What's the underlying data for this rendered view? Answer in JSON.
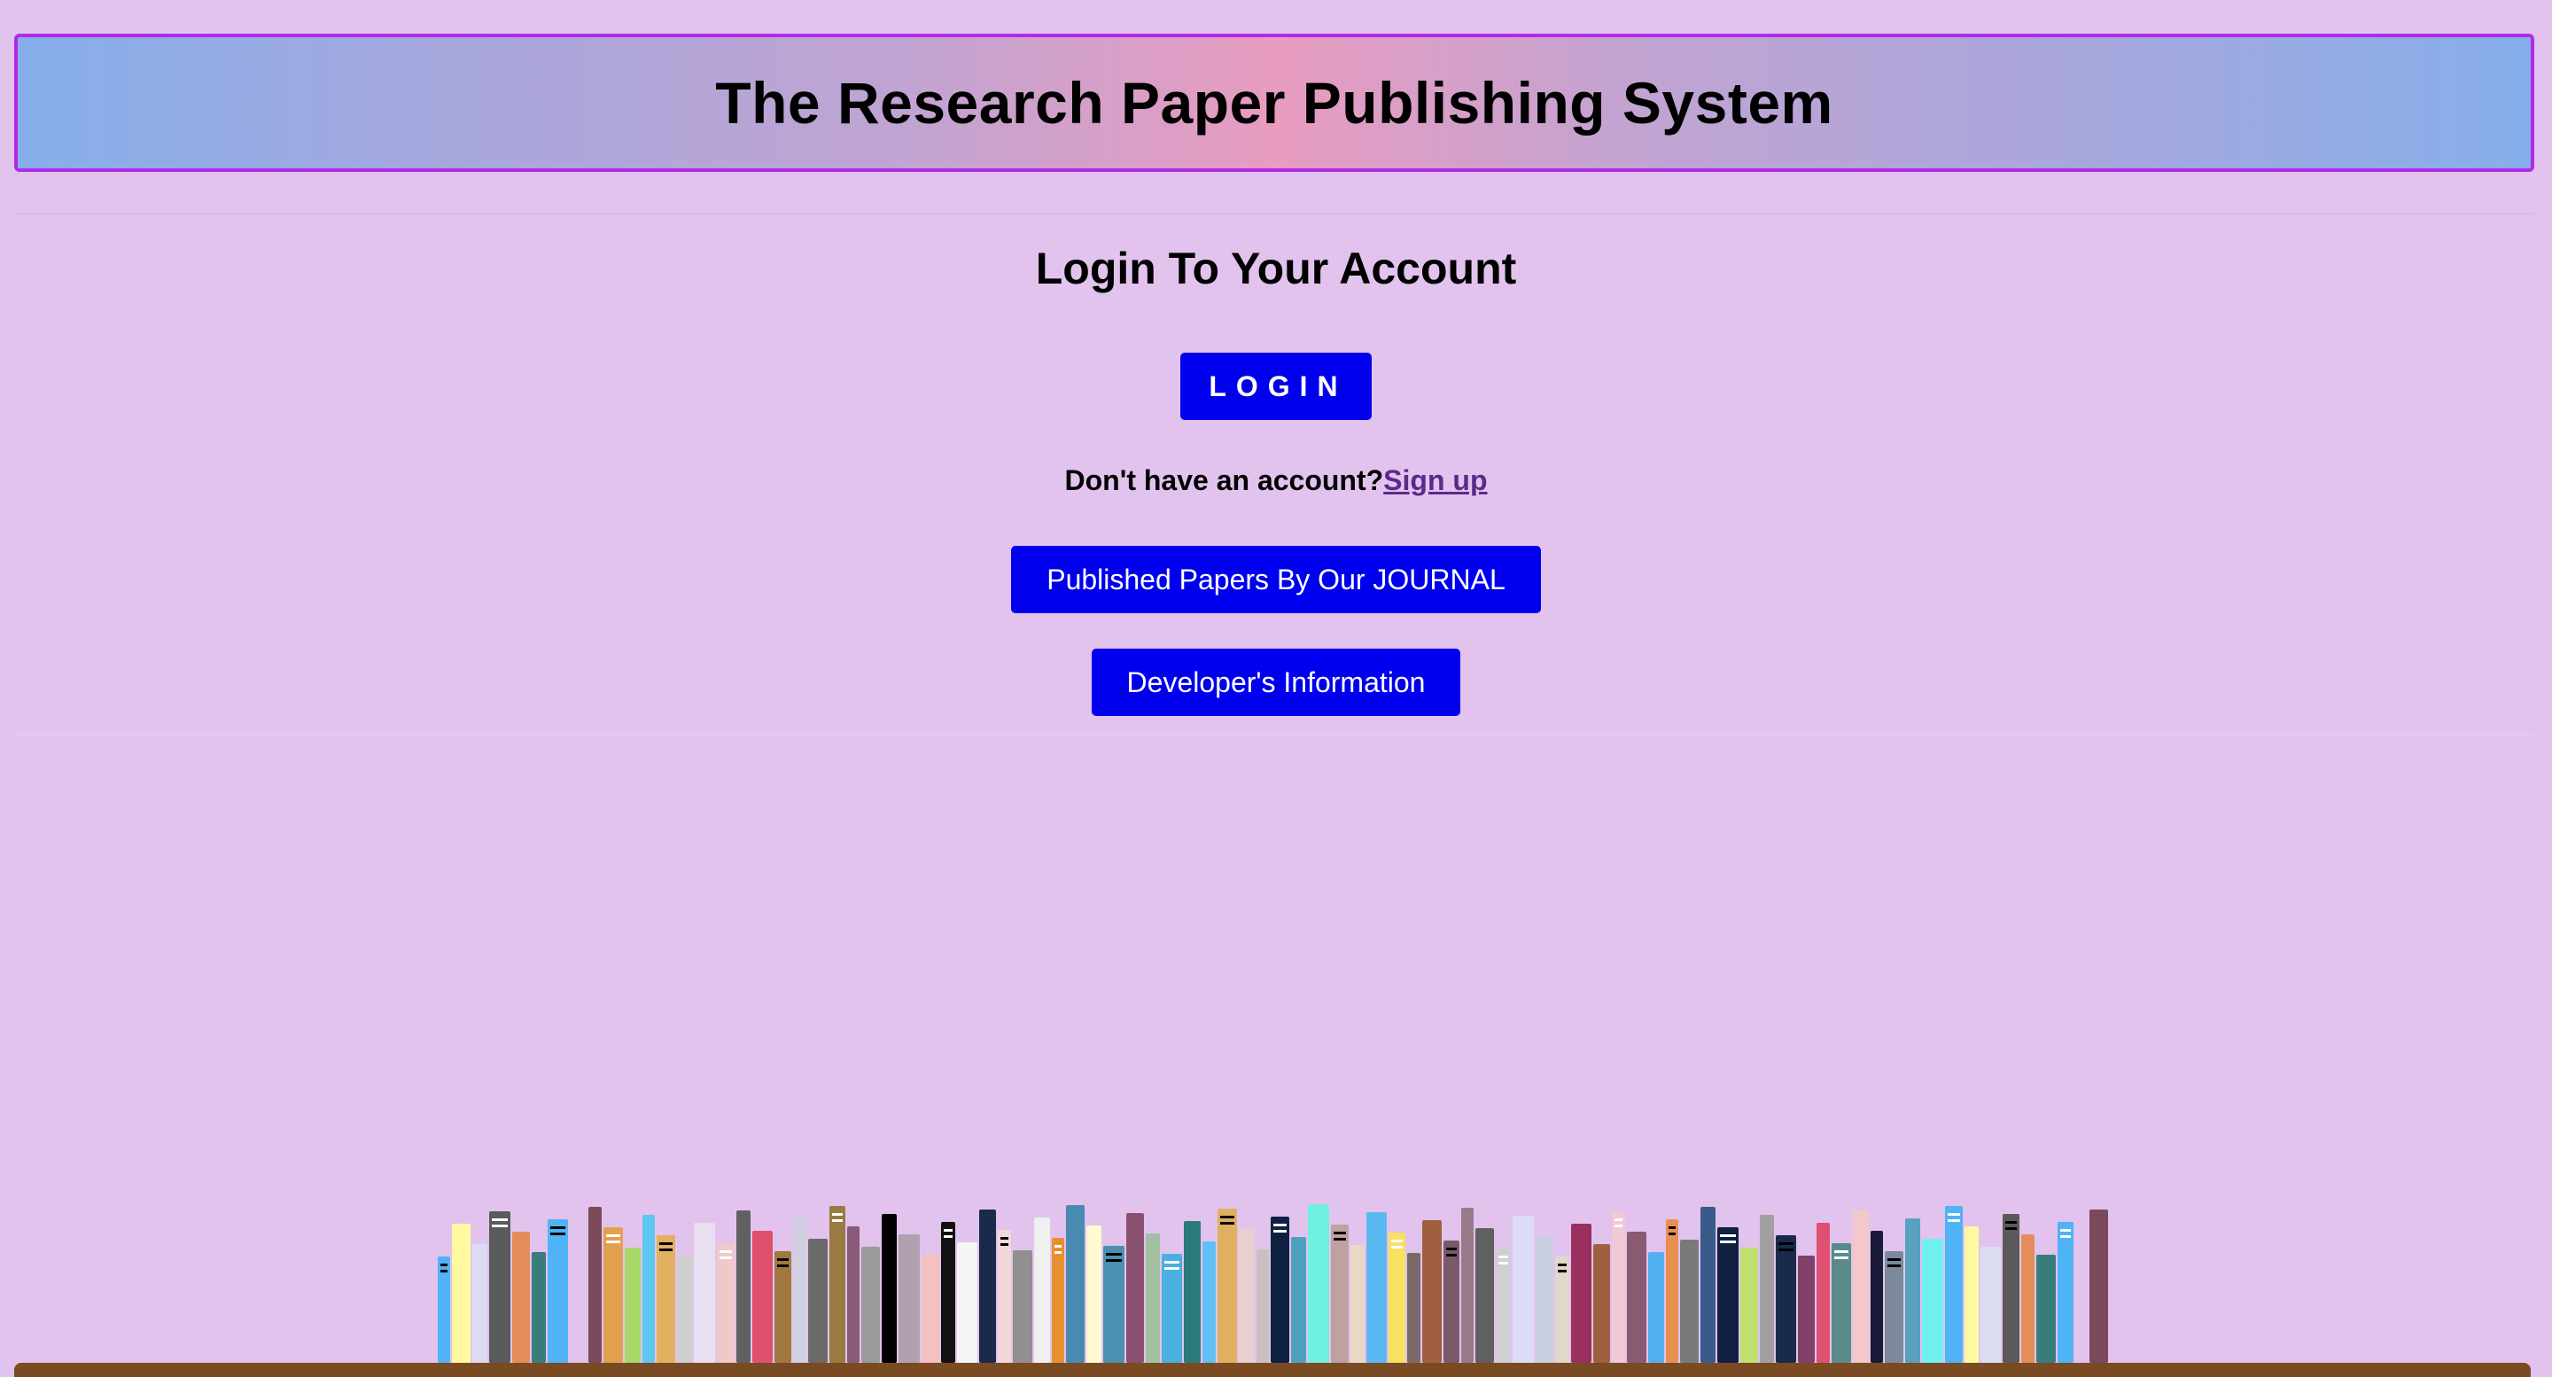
{
  "header": {
    "title": "The Research Paper Publishing System"
  },
  "login": {
    "heading": "Login To Your Account",
    "login_button": "LOGIN",
    "no_account_text": "Don't have an account?",
    "signup_link": "Sign up"
  },
  "nav": {
    "papers_button": "Published Papers By Our JOURNAL",
    "developer_button": "Developer's Information"
  },
  "colors": {
    "background": "#e2c3ee",
    "button": "#0000ee",
    "header_border": "#b02be8",
    "shelf": "#7a4a22"
  },
  "decoration": {
    "books_icon": "bookshelf-icon"
  }
}
